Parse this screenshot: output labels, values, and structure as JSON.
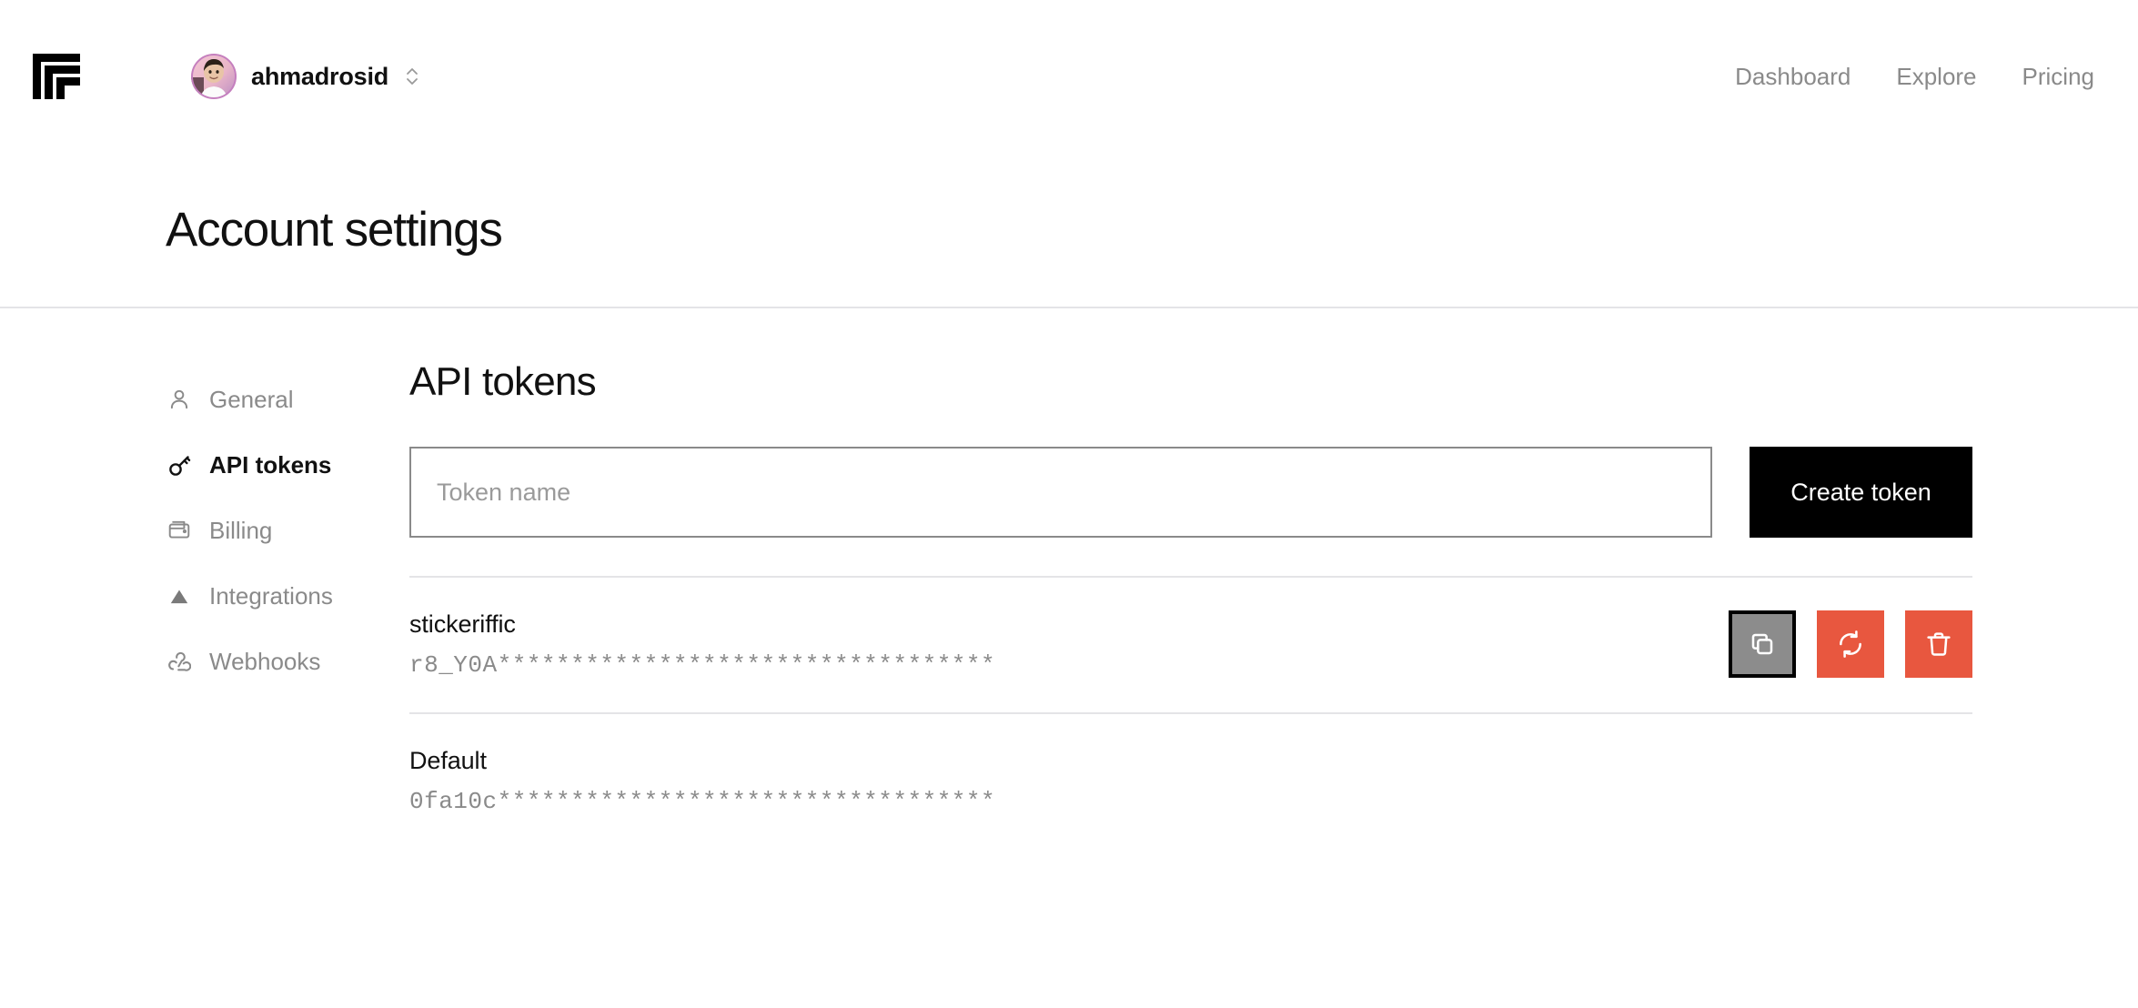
{
  "header": {
    "logo_icon": "replicate-logo-icon",
    "user": {
      "name": "ahmadrosid",
      "avatar_icon": "user-avatar",
      "switcher_icon": "chevron-up-down-icon"
    },
    "nav": [
      {
        "label": "Dashboard"
      },
      {
        "label": "Explore"
      },
      {
        "label": "Pricing"
      }
    ]
  },
  "page": {
    "title": "Account settings"
  },
  "sidebar": {
    "items": [
      {
        "label": "General",
        "icon": "user-icon",
        "active": false
      },
      {
        "label": "API tokens",
        "icon": "key-icon",
        "active": true
      },
      {
        "label": "Billing",
        "icon": "wallet-icon",
        "active": false
      },
      {
        "label": "Integrations",
        "icon": "triangle-icon",
        "active": false
      },
      {
        "label": "Webhooks",
        "icon": "webhook-icon",
        "active": false
      }
    ]
  },
  "main": {
    "title": "API tokens",
    "create": {
      "input_value": "",
      "placeholder": "Token name",
      "button_label": "Create token"
    },
    "tokens": [
      {
        "name": "stickeriffic",
        "value": "r8_Y0A**********************************",
        "actions": [
          {
            "name": "copy-token-button",
            "icon": "copy-icon",
            "style": "gray",
            "focused": true
          },
          {
            "name": "regenerate-token-button",
            "icon": "refresh-icon",
            "style": "orange",
            "focused": false
          },
          {
            "name": "delete-token-button",
            "icon": "trash-icon",
            "style": "orange",
            "focused": false
          }
        ]
      },
      {
        "name": "Default",
        "value": "0fa10c**********************************",
        "actions": []
      }
    ]
  },
  "colors": {
    "accent_orange": "#e8573f",
    "button_gray": "#8c8c8c",
    "text_muted": "#8a8a8a",
    "divider": "#e4e4e7",
    "black": "#000000"
  }
}
